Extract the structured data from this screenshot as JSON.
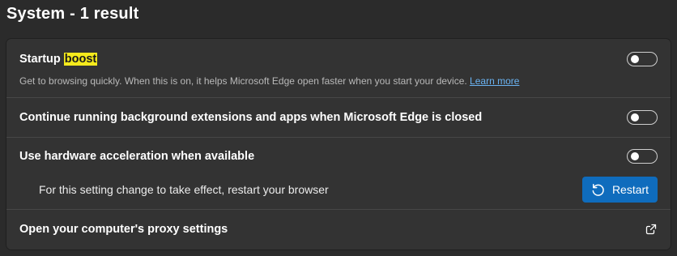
{
  "page": {
    "title": "System - 1 result"
  },
  "settings": {
    "startup_boost": {
      "title_prefix": "Startup ",
      "title_highlight": "boost",
      "description": "Get to browsing quickly. When this is on, it helps Microsoft Edge open faster when you start your device. ",
      "learn_more": "Learn more",
      "enabled": false
    },
    "background_apps": {
      "title": "Continue running background extensions and apps when Microsoft Edge is closed",
      "enabled": false
    },
    "hardware_acceleration": {
      "title": "Use hardware acceleration when available",
      "enabled": false,
      "restart_notice": "For this setting change to take effect, restart your browser",
      "restart_label": "Restart"
    },
    "proxy": {
      "title": "Open your computer's proxy settings"
    }
  },
  "colors": {
    "accent": "#0f6cbd",
    "highlight": "#f5ea1c",
    "link": "#6ab3f2",
    "background": "#2b2b2b",
    "card": "#333333"
  },
  "icons": {
    "restart": "restart-icon",
    "external": "open-external-icon"
  }
}
